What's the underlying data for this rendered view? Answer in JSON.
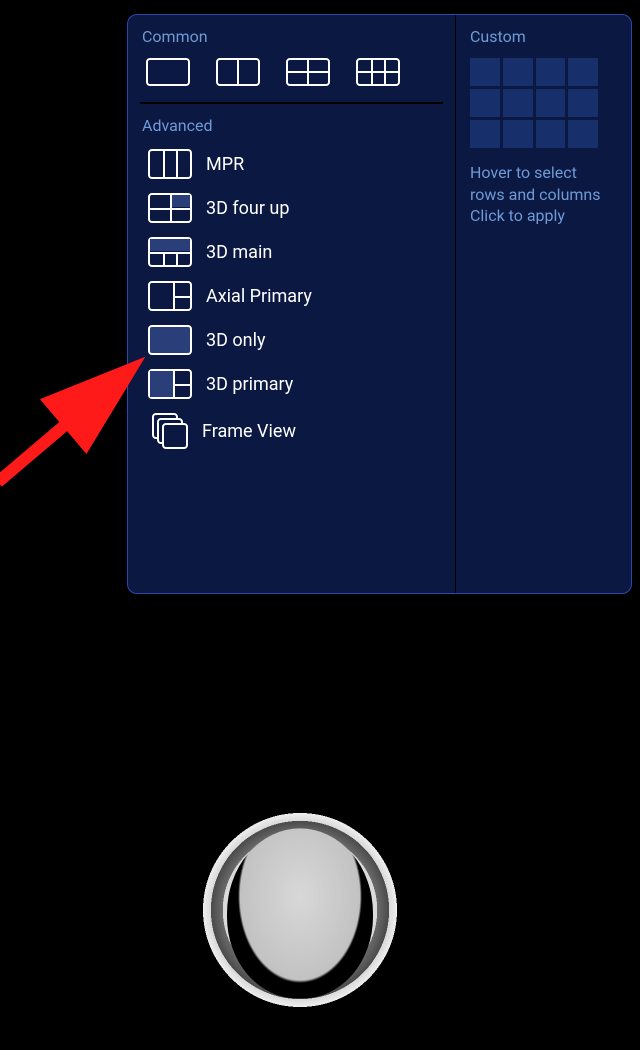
{
  "sections": {
    "common_title": "Common",
    "advanced_title": "Advanced",
    "custom_title": "Custom"
  },
  "advanced": {
    "mpr": "MPR",
    "four_up": "3D four up",
    "main": "3D main",
    "axial": "Axial Primary",
    "only": "3D only",
    "primary": "3D primary",
    "frame": "Frame View"
  },
  "custom": {
    "hover_line1": "Hover to select",
    "hover_line2": "rows and columns",
    "hover_line3": "Click to apply"
  }
}
